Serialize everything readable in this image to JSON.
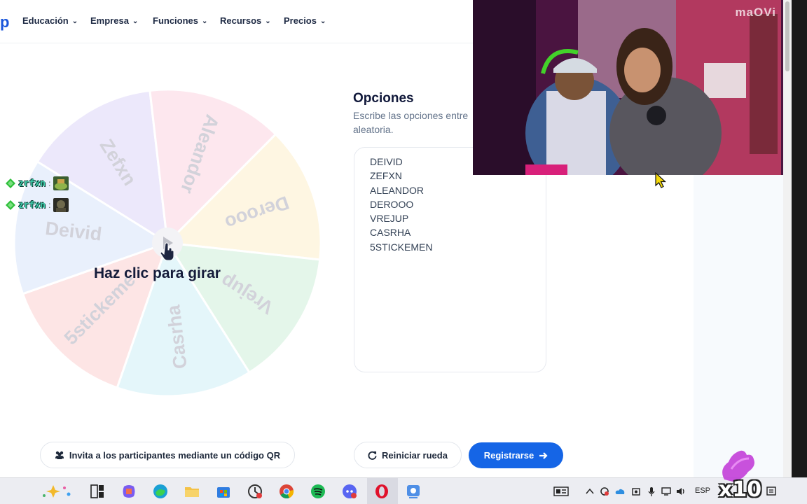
{
  "nav": {
    "logo": "p",
    "items": [
      {
        "label": "Educación"
      },
      {
        "label": "Empresa"
      },
      {
        "label": "Funciones"
      },
      {
        "label": "Recursos"
      },
      {
        "label": "Precios"
      }
    ],
    "chevron": "⌄"
  },
  "wheel": {
    "segments": [
      {
        "label": "Zefxn",
        "color": "#ece8fb"
      },
      {
        "label": "Aleandor",
        "color": "#fde7ee"
      },
      {
        "label": "Derooo",
        "color": "#fef6e2"
      },
      {
        "label": "Vrejup",
        "color": "#e4f6ea"
      },
      {
        "label": "Casrha",
        "color": "#e4f6fa"
      },
      {
        "label": "5stickeme",
        "color": "#fde5e5"
      },
      {
        "label": "Deivid",
        "color": "#e9f0fc"
      }
    ],
    "spin_text": "Haz clic para girar"
  },
  "chat": [
    {
      "user": "zrfxn",
      "sep": ":"
    },
    {
      "user": "zrfxn",
      "sep": ":"
    }
  ],
  "options": {
    "title": "Opciones",
    "description": "Escribe las opciones entre aleatoria.",
    "items": [
      "DEIVID",
      "ZEFXN",
      "ALEANDOR",
      "DEROOO",
      "VREJUP",
      "CASRHA",
      "5STICKEMEN"
    ]
  },
  "buttons": {
    "qr": "Invita a los participantes mediante un código QR",
    "reset": "Reiniciar rueda",
    "register": "Registrarse"
  },
  "webcam": {
    "label": "maOVi"
  },
  "taskbar": {
    "lang": "ESP"
  },
  "overlay": {
    "multiplier": "x10"
  },
  "colors": {
    "accent": "#1565e6",
    "title": "#10183a"
  }
}
